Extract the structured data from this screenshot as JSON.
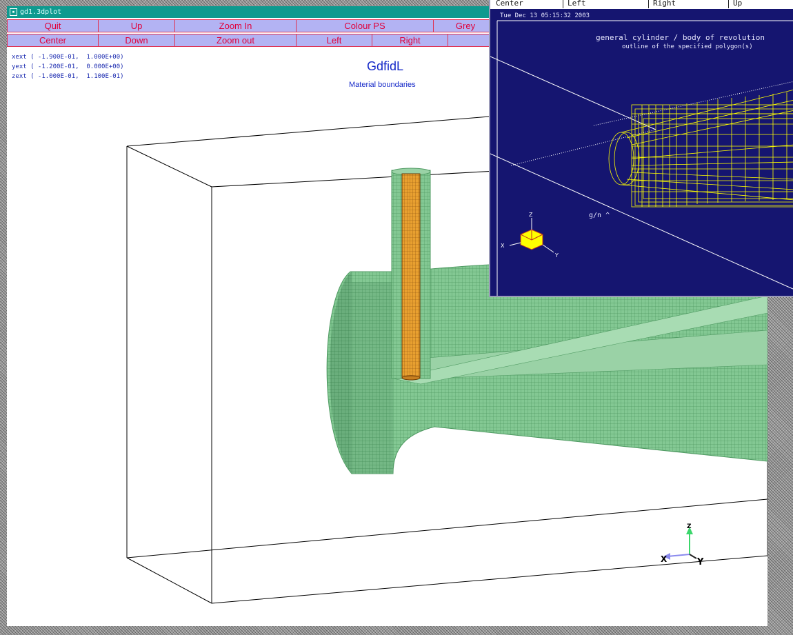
{
  "window": {
    "title": "gd1.3dplot"
  },
  "toolbar": {
    "row1": [
      "Quit",
      "Up",
      "Zoom In",
      "Colour PS",
      "Grey"
    ],
    "row2": [
      "Center",
      "Down",
      "Zoom out",
      "Left",
      "Right"
    ]
  },
  "extents": [
    "xext ( -1.900E-01,  1.000E+00)",
    "yext ( -1.200E-01,  0.000E+00)",
    "zext ( -1.000E-01,  1.100E-01)"
  ],
  "plot": {
    "title": "GdfidL",
    "subtitle": "Material boundaries"
  },
  "axes_main": {
    "z": "Z",
    "x": "X",
    "y": "Y"
  },
  "second_window": {
    "menu": [
      "Center",
      "Left",
      "Right",
      "Up"
    ],
    "timestamp": "Tue Dec 13 05:15:32 2003",
    "title": "general cylinder / body of revolution",
    "subtitle": "outline of the specified polygon(s)",
    "label": "g/n ^",
    "axes": {
      "z": "Z",
      "x": "X",
      "y": "Y"
    }
  },
  "colors": {
    "title_bar": "#0e9a8f",
    "button_bg": "#b3b3f3",
    "button_text": "#e0003a",
    "blue_text": "#1428c8",
    "geometry_green": "#7fc48e",
    "antenna_orange": "#e8a030",
    "wire_yellow": "#ffff00",
    "second_bg": "#151570"
  }
}
